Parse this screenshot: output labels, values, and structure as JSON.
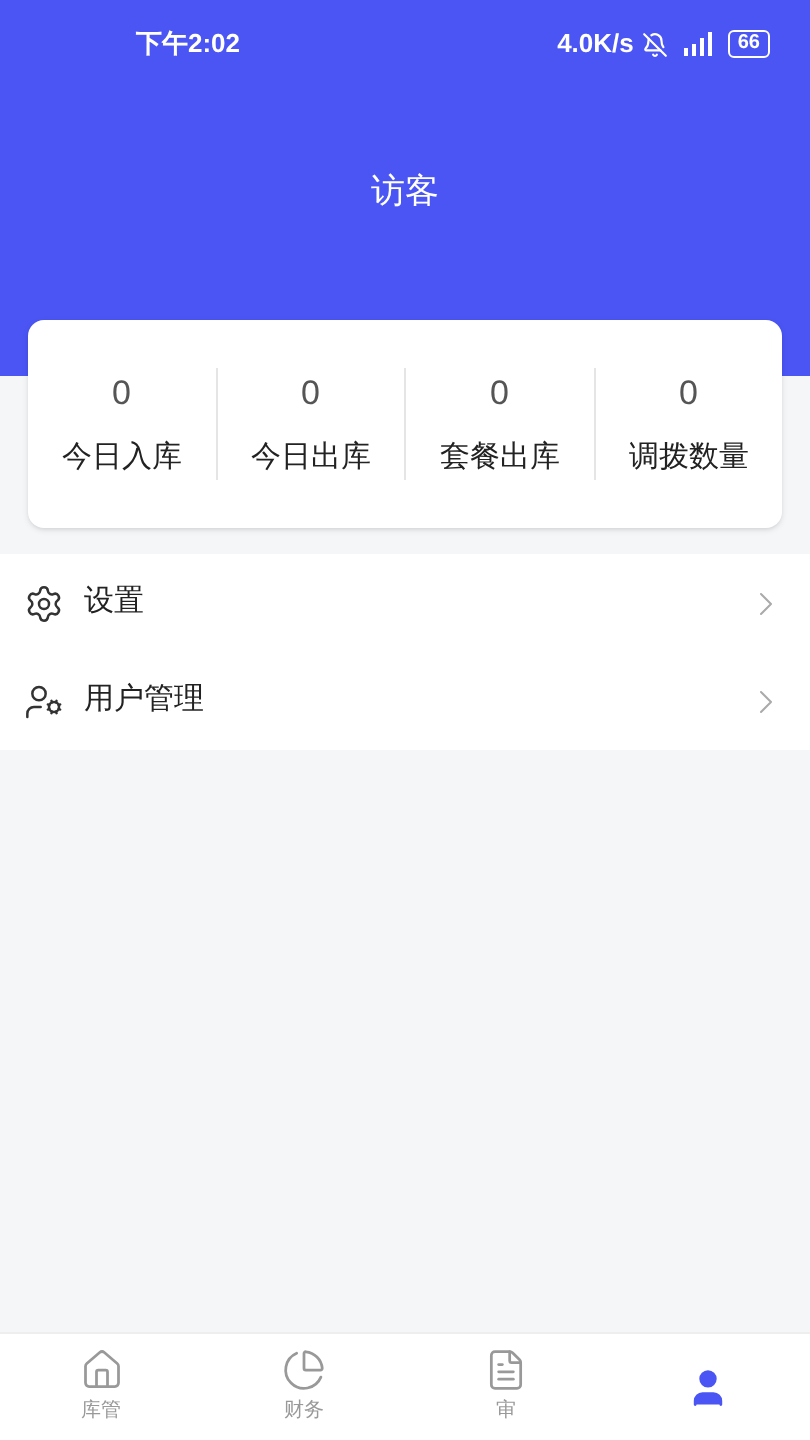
{
  "status_bar": {
    "time": "下午2:02",
    "speed": "4.0K/s",
    "battery": "66"
  },
  "header": {
    "title": "访客"
  },
  "stats": [
    {
      "value": "0",
      "label": "今日入库"
    },
    {
      "value": "0",
      "label": "今日出库"
    },
    {
      "value": "0",
      "label": "套餐出库"
    },
    {
      "value": "0",
      "label": "调拨数量"
    }
  ],
  "menu": [
    {
      "kind": "settings",
      "label": "设置"
    },
    {
      "kind": "users",
      "label": "用户管理"
    }
  ],
  "tabs": [
    {
      "kind": "home",
      "label": "库管",
      "selected": false
    },
    {
      "kind": "finance",
      "label": "财务",
      "selected": false
    },
    {
      "kind": "review",
      "label": "审",
      "selected": false
    },
    {
      "kind": "profile",
      "selected": true
    }
  ]
}
